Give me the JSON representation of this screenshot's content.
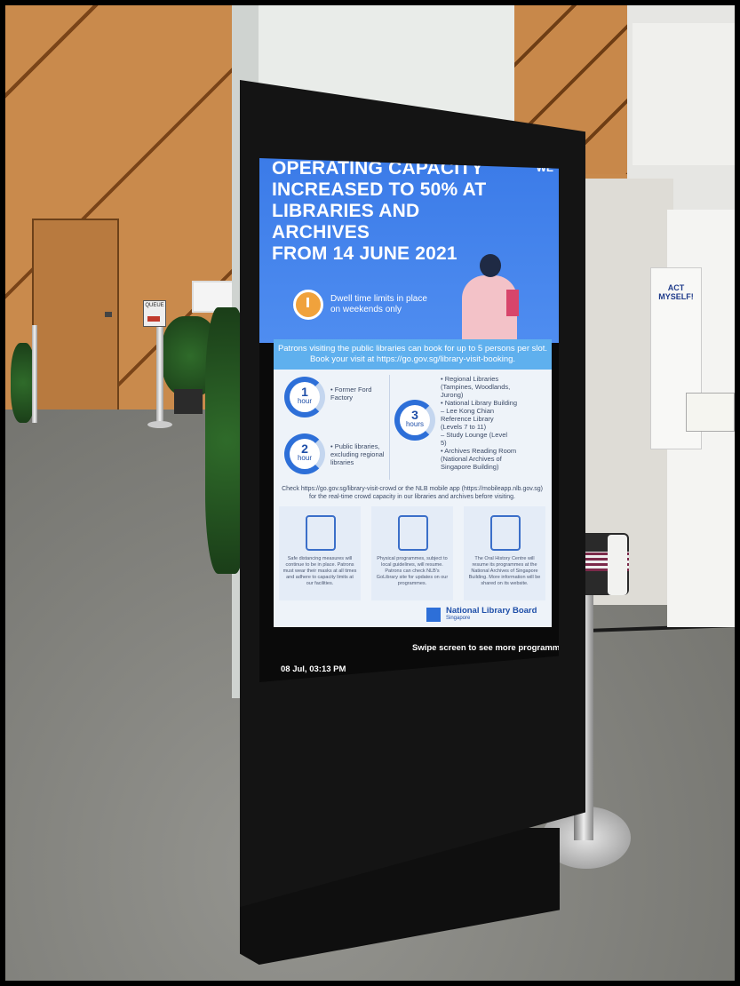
{
  "scene": {
    "colors": {
      "wood": "#c98a4c",
      "kiosk": "#141414",
      "screen_blue": "#3b7be8",
      "floor": "#7e7e79"
    }
  },
  "queue_sign": {
    "label": "QUEUE"
  },
  "right_poster": {
    "title": "ACT MYSELF!"
  },
  "kiosk": {
    "hero": {
      "title": "OPERATING CAPACITY\nINCREASED TO 50% AT\nLIBRARIES AND ARCHIVES\nFROM 14 JUNE 2021",
      "tag": "WE",
      "dwell_note": "Dwell time limits in place\non weekends only",
      "timer_icon": "stopwatch-icon"
    },
    "notice": "Patrons visiting the public libraries can book for up to 5 persons per slot.\nBook your visit at https://go.gov.sg/library-visit-booking.",
    "dwell_limits": [
      {
        "value": "1",
        "unit": "hour",
        "label": "• Former Ford\nFactory"
      },
      {
        "value": "2",
        "unit": "hour",
        "label": "• Public libraries,\nexcluding regional\nlibraries"
      },
      {
        "value": "3",
        "unit": "hours",
        "label": "• Regional Libraries\n(Tampines, Woodlands,\nJurong)\n• National Library Building\n– Lee Kong Chian\nReference Library\n(Levels 7 to 11)\n– Study Lounge (Level\n5)\n• Archives Reading Room\n(National Archives of\nSingapore Building)"
      }
    ],
    "check_text": "Check https://go.gov.sg/library-visit-crowd or the NLB mobile app (https://mobileapp.nlb.gov.sg) for the real-time crowd capacity in our libraries and archives before visiting.",
    "rules": [
      {
        "icon": "distancing-icon",
        "text": "Safe distancing measures will continue to be in place. Patrons must wear their masks at all times and adhere to capacity limits at our facilities."
      },
      {
        "icon": "bookshelf-icon",
        "text": "Physical programmes, subject to local guidelines, will resume. Patrons can check NLB's GoLibrary site for updates on our programmes."
      },
      {
        "icon": "camera-icon",
        "text": "The Oral History Centre will resume its programmes at the National Archives of Singapore Building. More information will be shared on its website."
      }
    ],
    "brand": {
      "name": "National Library Board",
      "sub": "Singapore",
      "short": "NLB"
    },
    "footer": {
      "timestamp": "08 Jul, 03:13 PM",
      "swipe_hint": "Swipe screen to see more programmes."
    }
  }
}
